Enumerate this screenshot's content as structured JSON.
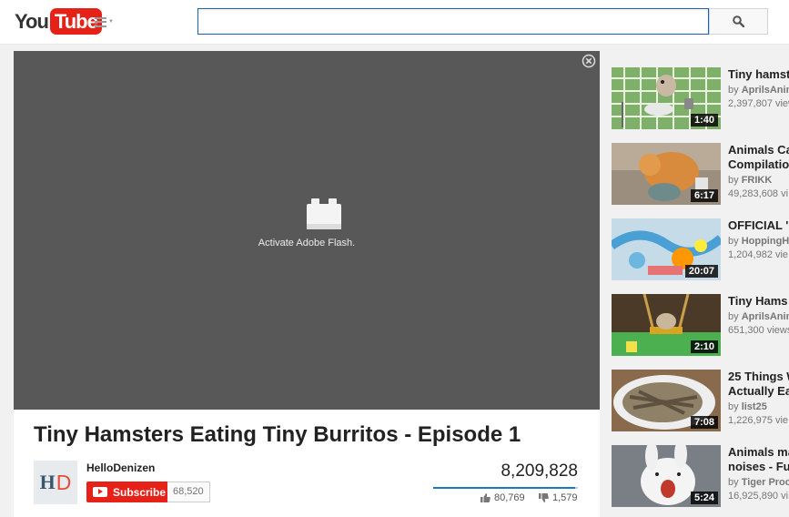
{
  "brand": {
    "logo_you": "You",
    "logo_tube": "Tube"
  },
  "search": {
    "value": "",
    "placeholder": ""
  },
  "player": {
    "flash_message": "Activate Adobe Flash."
  },
  "video": {
    "title": "Tiny Hamsters Eating Tiny Burritos - Episode 1",
    "channel": "HelloDenizen",
    "avatar_letters": {
      "h": "H",
      "d": "D"
    },
    "subscribe_label": "Subscribe",
    "subscriber_count": "68,520",
    "views": "8,209,828",
    "likes": "80,769",
    "dislikes": "1,579",
    "like_ratio": 0.981
  },
  "related": [
    {
      "title": "Tiny hamst",
      "by": "by ",
      "channel": "AprilsAnim",
      "views": "2,397,807 view",
      "duration": "1:40",
      "title_lines": 1
    },
    {
      "title": "Animals Ca\nCompilatio",
      "by": "by ",
      "channel": "FRIKK",
      "views": "49,283,608 vi",
      "duration": "6:17",
      "title_lines": 2
    },
    {
      "title": "OFFICIAL '",
      "by": "by ",
      "channel": "HoppingH",
      "views": "1,204,982 vie",
      "duration": "20:07",
      "title_lines": 1
    },
    {
      "title": "Tiny Hams",
      "by": "by ",
      "channel": "AprilsAnim",
      "views": "651,300 views",
      "duration": "2:10",
      "title_lines": 1
    },
    {
      "title": "25 Things W\nActually Ea",
      "by": "by ",
      "channel": "list25",
      "views": "1,226,975 vie",
      "duration": "7:08",
      "title_lines": 2
    },
    {
      "title": "Animals ma\nnoises - Fu",
      "by": "by ",
      "channel": "Tiger Proc",
      "views": "16,925,890 vi",
      "duration": "5:24",
      "title_lines": 2
    }
  ]
}
